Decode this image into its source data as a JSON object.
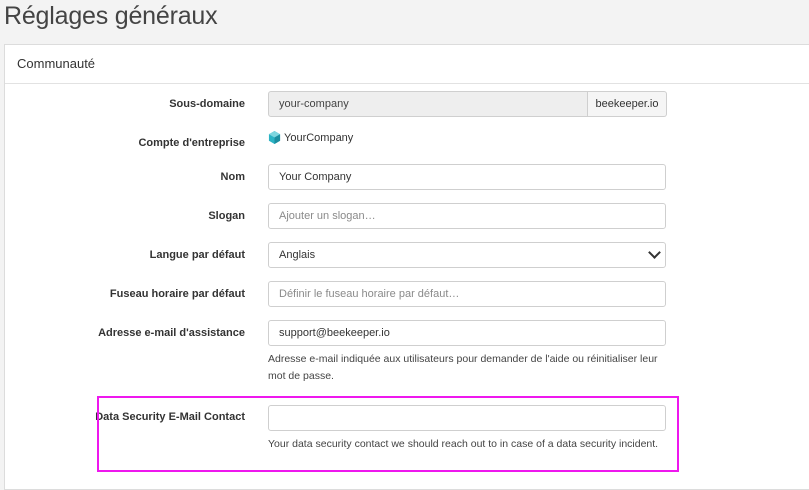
{
  "page": {
    "title": "Réglages généraux"
  },
  "panel": {
    "title": "Communauté"
  },
  "fields": {
    "subdomain": {
      "label": "Sous-domaine",
      "value": "your-company",
      "suffix": "beekeeper.io"
    },
    "company_account": {
      "label": "Compte d'entreprise",
      "value": "YourCompany"
    },
    "name": {
      "label": "Nom",
      "value": "Your Company"
    },
    "slogan": {
      "label": "Slogan",
      "placeholder": "Ajouter un slogan…"
    },
    "language": {
      "label": "Langue par défaut",
      "value": "Anglais"
    },
    "timezone": {
      "label": "Fuseau horaire par défaut",
      "placeholder": "Définir le fuseau horaire par défaut…"
    },
    "support_email": {
      "label": "Adresse e-mail d'assistance",
      "value": "support@beekeeper.io",
      "help": "Adresse e-mail indiquée aux utilisateurs pour demander de l'aide ou réinitialiser leur mot de passe."
    },
    "data_security_email": {
      "label": "Data Security E-Mail Contact",
      "value": "",
      "help": "Your data security contact we should reach out to in case of a data security incident."
    }
  },
  "colors": {
    "highlight": "#ee18ee",
    "logo": "#2bb3c4"
  },
  "icons": {
    "company_logo": "company-logo-icon",
    "select_arrow": "chevron-down-icon"
  }
}
